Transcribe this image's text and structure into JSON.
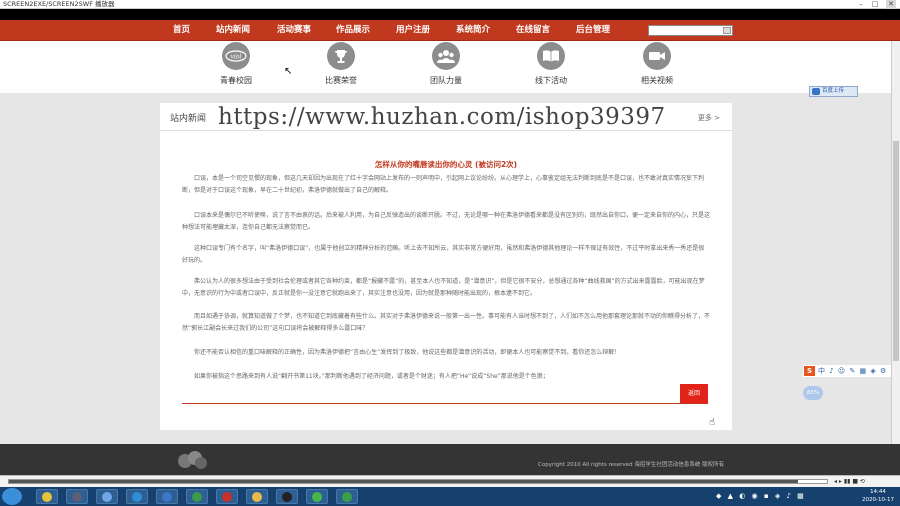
{
  "window": {
    "title": "SCREEN2EXE/SCREEN2SWF 播放器",
    "minimize": "–",
    "maximize": "□",
    "close": "✕"
  },
  "nav": {
    "items": [
      {
        "label": "首页"
      },
      {
        "label": "站内新闻"
      },
      {
        "label": "活动赛事"
      },
      {
        "label": "作品展示"
      },
      {
        "label": "用户注册"
      },
      {
        "label": "系统简介"
      },
      {
        "label": "在线留言"
      },
      {
        "label": "后台管理"
      }
    ],
    "search_value": ""
  },
  "quick_links": [
    {
      "label": "青春校园",
      "icon": "viol-logo-icon"
    },
    {
      "label": "比赛荣誉",
      "icon": "trophy-icon"
    },
    {
      "label": "团队力量",
      "icon": "team-icon"
    },
    {
      "label": "线下活动",
      "icon": "book-icon"
    },
    {
      "label": "相关视频",
      "icon": "video-camera-icon"
    }
  ],
  "panel": {
    "title": "站内新闻",
    "more": "更多 >",
    "watermark": "https://www.huzhan.com/ishop39397",
    "article": {
      "title": "怎样从你的嘴唇读出你的心灵 (被访问2次)",
      "paragraphs": [
        "口误，本是一个司空见惯的现象，但这几天却因为出现在了红十字会网站上发布的一则声明中，引起网上议论纷纷。从心理学上，心事鉴定组无法判断到底是不是口误，也不敢对真实情况妄下判断，但是对于口误这个现象，早在二十世纪初，弗洛伊德就做出了自己的解释。",
        "口误本来是偶尔已不听使唤，说了言不由衷的话。后来被人利用，为自己反弹造出的谈断开脱。不过，无论是哪一种在弗洛伊德看来都是没有区别的，既然出自你口，便一定来自你的内心，只是这种想法可能埋藏太深，连你自己都无法察觉而已。",
        "这种口误专门有个名字，叫“弗洛伊德口误”，也属于他创立的精神分析的范畴。听上去不知所云，其实非常方便好用，虽然和弗洛伊德其他理论一样不保证有效性，不过平时拿出来秀一秀还是很好玩的。",
        "弗公认为人的很多想法由于受到社会伦理或者其它各种约束，都是“报藏不露”的，甚至本人也不知道，是“潜意识”。但是它很不安分，总想通过各种“曲线救国”的方式出来露露脸，可能出现在梦中，无意识的行为中或者口误中，反正就是你一没注意它就跑出来了，其实注意也没用，因为就是那种随时能出现的，根本逮不到它。",
        "而且如遇于协调，就算知道做了个梦，也不知道它到底藏着有些什么。其实对于弗洛伊德来说一般第一出一性。事可能有人当时想不到了，人们如不怎么用他那套理论那就不动的你瞧得分析了，不然“郭长江副会长来过我们的公司”这句口误将会被解释得多么露口味？",
        "你还不能否认相信的重口味解释的正确性，因为弗洛伊德把“言由心生”发挥到了极致，他说这些都是潜意识的活动，即便本人也可能察觉不到。看你还怎么辩解！",
        "如果你被指这个思路来到有人说“翻开书第11块。”那判断他遇到了经济问题，或者是个财迷；有人把“He”说成“She”那说他是个色狼；"
      ],
      "back_button": "返回"
    }
  },
  "side": {
    "upload_button": "百度上传",
    "ime_label": "中",
    "ime_bubble": "85%"
  },
  "footer": {
    "copyright": "Copyright 2010 All rights reserved 海招学生社团活动信息系统 版权所有"
  },
  "player": {
    "progress": 0.965,
    "controls": "◂ ▸ ▮▮ ■ ⟲"
  },
  "taskbar": {
    "apps": [
      {
        "name": "chrome-app",
        "color": "#e4c33b"
      },
      {
        "name": "media-app",
        "color": "#5e5e7a"
      },
      {
        "name": "baidu-app",
        "color": "#6fa6e6"
      },
      {
        "name": "browser-app",
        "color": "#2f8ed8"
      },
      {
        "name": "mail-app",
        "color": "#3a78c8"
      },
      {
        "name": "doc-app",
        "color": "#3c9a4a"
      },
      {
        "name": "flash-app",
        "color": "#c7312b"
      },
      {
        "name": "folder-app",
        "color": "#e8b84a"
      },
      {
        "name": "qq-app",
        "color": "#222222"
      },
      {
        "name": "wechat-app",
        "color": "#47b649"
      },
      {
        "name": "recorder-app",
        "color": "#37a14a"
      }
    ],
    "tray": "◆ ▲ ◐ ◉ ▪ ◈ ♪ ▦",
    "time": "14:44",
    "date": "2020-10-17"
  }
}
